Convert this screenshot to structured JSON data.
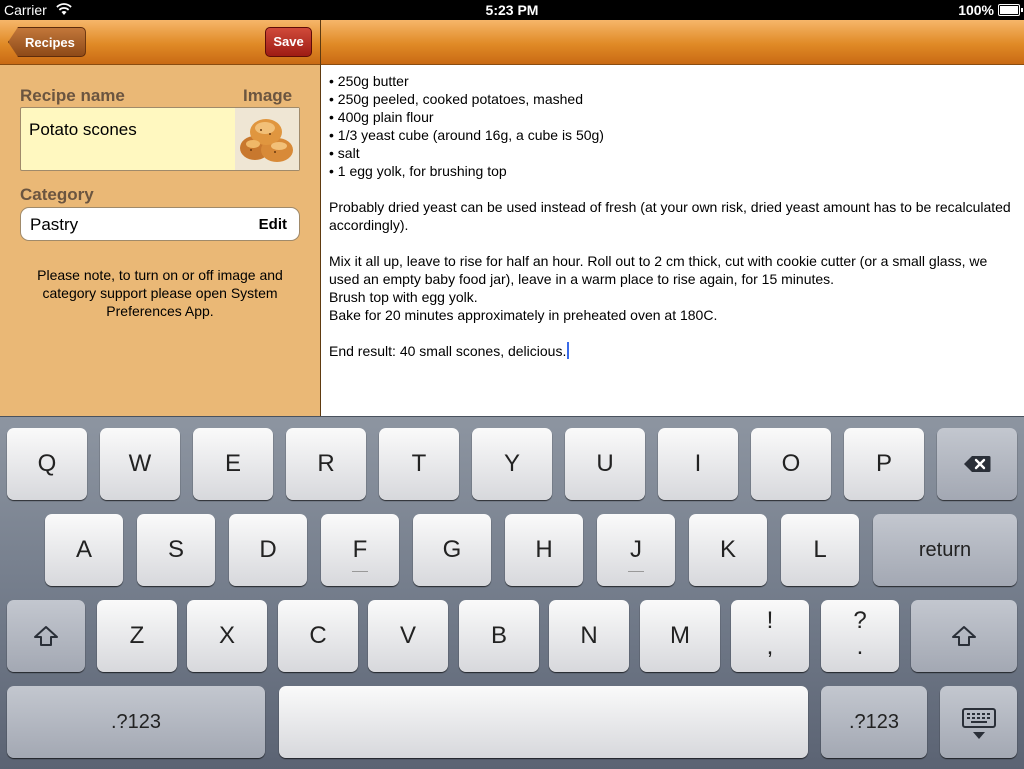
{
  "status_bar": {
    "carrier": "Carrier",
    "time": "5:23 PM",
    "battery": "100%"
  },
  "left_panel": {
    "nav": {
      "back_label": "Recipes",
      "save_label": "Save"
    },
    "recipe_name_label": "Recipe name",
    "image_label": "Image",
    "recipe_name_value": "Potato scones",
    "category_label": "Category",
    "category_value": "Pastry",
    "category_edit": "Edit",
    "note": "Please note, to turn on or off image and category support please open System Preferences App."
  },
  "recipe_text": {
    "lines": [
      "• 250g butter",
      "• 250g peeled, cooked potatoes, mashed",
      "• 400g plain flour",
      "• 1/3 yeast cube (around 16g, a cube is 50g)",
      "• salt",
      "• 1 egg yolk, for brushing top",
      "",
      "Probably dried yeast can be used instead of fresh (at your own risk, dried yeast amount has to be recalculated accordingly).",
      "",
      "Mix it all up, leave to rise for half an hour. Roll out to 2 cm thick, cut with cookie cutter (or a small glass, we used an empty baby food jar), leave in a warm place to rise again, for 15 minutes.",
      "Brush top with egg yolk.",
      "Bake for 20 minutes approximately in preheated oven at 180C.",
      "",
      "End result: 40 small scones, delicious."
    ]
  },
  "keyboard": {
    "row1": [
      "Q",
      "W",
      "E",
      "R",
      "T",
      "Y",
      "U",
      "I",
      "O",
      "P"
    ],
    "row2": [
      "A",
      "S",
      "D",
      "F",
      "G",
      "H",
      "J",
      "K",
      "L"
    ],
    "row3": [
      "Z",
      "X",
      "C",
      "V",
      "B",
      "N",
      "M"
    ],
    "return_label": "return",
    "exclaim_top": "!",
    "exclaim_bottom": ",",
    "question_top": "?",
    "question_bottom": ".",
    "numbers_label": ".?123",
    "icons": {
      "delete": "delete-icon",
      "shift": "shift-icon",
      "dismiss": "keyboard-dismiss-icon"
    }
  },
  "colors": {
    "nav_orange": "#e08a26",
    "left_bg": "#eab876",
    "save_red": "#b8281c",
    "name_field_bg": "#fff8c0"
  }
}
